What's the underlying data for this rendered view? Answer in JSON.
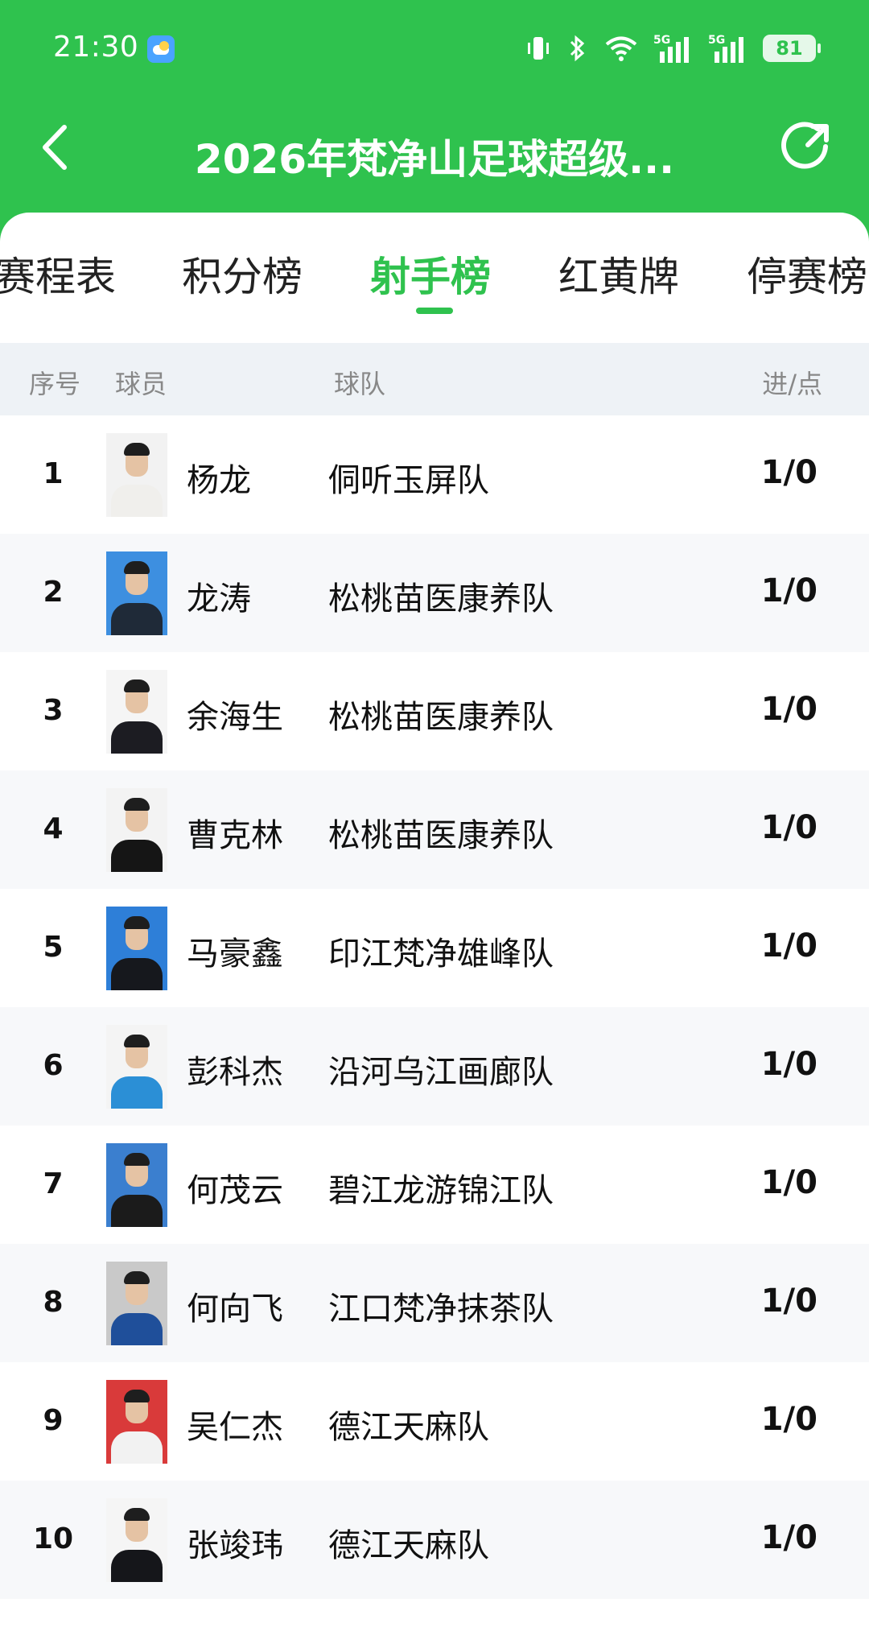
{
  "status_bar": {
    "time": "21:30",
    "battery": "81",
    "icons": [
      "weather-icon",
      "vibrate-icon",
      "bluetooth-icon",
      "wifi-icon",
      "signal-5g-icon",
      "signal-5g-icon",
      "battery-icon"
    ],
    "signal_1_label": "5G",
    "signal_2_label": "5G"
  },
  "header": {
    "title": "2026年梵净山足球超级...",
    "back_icon": "chevron-left-icon",
    "share_icon": "share-icon",
    "background": "#2fc24e"
  },
  "tabs": [
    {
      "label": "赛程表",
      "active": false
    },
    {
      "label": "积分榜",
      "active": false
    },
    {
      "label": "射手榜",
      "active": true
    },
    {
      "label": "红黄牌",
      "active": false
    },
    {
      "label": "停赛榜",
      "active": false
    }
  ],
  "table": {
    "headers": {
      "rank": "序号",
      "player": "球员",
      "team": "球队",
      "goals": "进/点"
    },
    "rows": [
      {
        "rank": "1",
        "name": "杨龙",
        "team": "侗听玉屏队",
        "score": "1/0",
        "photo_bg": "#f2f2f2",
        "shirt": "#f0efec"
      },
      {
        "rank": "2",
        "name": "龙涛",
        "team": "松桃苗医康养队",
        "score": "1/0",
        "photo_bg": "#3d8fe0",
        "shirt": "#1f2a38"
      },
      {
        "rank": "3",
        "name": "余海生",
        "team": "松桃苗医康养队",
        "score": "1/0",
        "photo_bg": "#f5f5f5",
        "shirt": "#1c1c22"
      },
      {
        "rank": "4",
        "name": "曹克林",
        "team": "松桃苗医康养队",
        "score": "1/0",
        "photo_bg": "#f3f3f3",
        "shirt": "#151515"
      },
      {
        "rank": "5",
        "name": "马豪鑫",
        "team": "印江梵净雄峰队",
        "score": "1/0",
        "photo_bg": "#2e7fd8",
        "shirt": "#16181d"
      },
      {
        "rank": "6",
        "name": "彭科杰",
        "team": "沿河乌江画廊队",
        "score": "1/0",
        "photo_bg": "#f4f4f4",
        "shirt": "#2b8fd6"
      },
      {
        "rank": "7",
        "name": "何茂云",
        "team": "碧江龙游锦江队",
        "score": "1/0",
        "photo_bg": "#3b7fcf",
        "shirt": "#1b1b1b"
      },
      {
        "rank": "8",
        "name": "何向飞",
        "team": "江口梵净抹茶队",
        "score": "1/0",
        "photo_bg": "#c9c9c9",
        "shirt": "#1f4f9a"
      },
      {
        "rank": "9",
        "name": "吴仁杰",
        "team": "德江天麻队",
        "score": "1/0",
        "photo_bg": "#d93a3a",
        "shirt": "#f2f2f2"
      },
      {
        "rank": "10",
        "name": "张竣玮",
        "team": "德江天麻队",
        "score": "1/0",
        "photo_bg": "#f5f5f5",
        "shirt": "#15161a"
      }
    ]
  }
}
